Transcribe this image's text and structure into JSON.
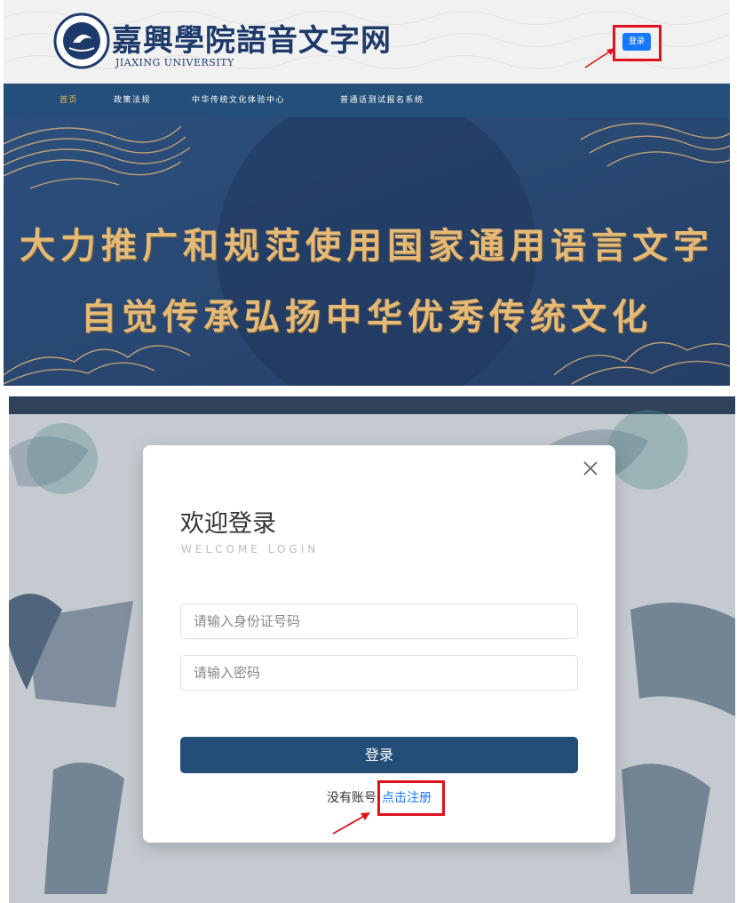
{
  "header": {
    "logo_title": "嘉興學院語音文字网",
    "logo_sub": "JIAXING UNIVERSITY",
    "login_button": "登录"
  },
  "nav": {
    "items": [
      {
        "label": "首页",
        "active": true
      },
      {
        "label": "政策法规",
        "active": false
      },
      {
        "label": "中华传统文化体验中心",
        "active": false
      },
      {
        "label": "普通话测试报名系统",
        "active": false
      }
    ]
  },
  "banner": {
    "line1": "大力推广和规范使用国家通用语言文字",
    "line2": "自觉传承弘扬中华优秀传统文化"
  },
  "login_modal": {
    "title": "欢迎登录",
    "subtitle": "WELCOME LOGIN",
    "id_placeholder": "请输入身份证号码",
    "password_placeholder": "请输入密码",
    "submit_label": "登录",
    "no_account": "没有账号",
    "register_link": "点击注册"
  },
  "colors": {
    "nav_bg": "#244f7b",
    "nav_active": "#f0b84c",
    "primary_blue": "#1677ff",
    "submit_bg": "#234e78",
    "highlight_red": "#e0121d",
    "slogan_gold": "#e5b976"
  }
}
